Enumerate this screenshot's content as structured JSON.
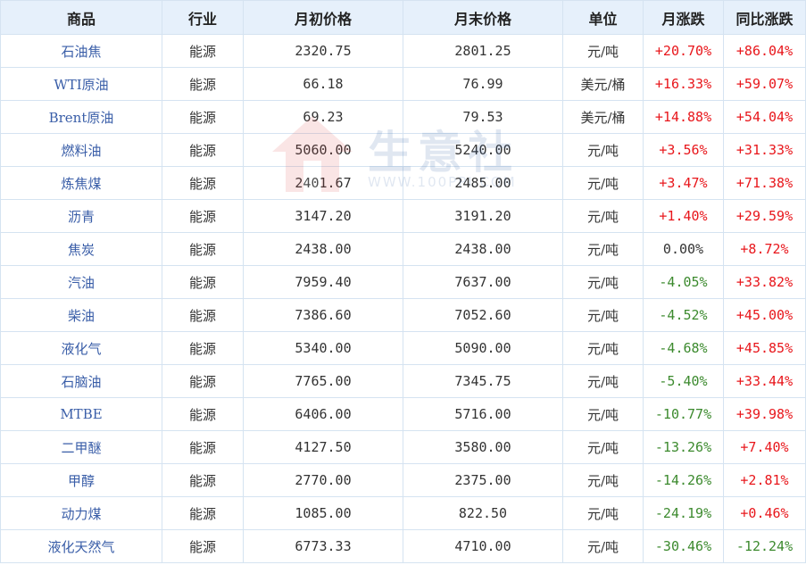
{
  "colors": {
    "up": "#e8161b",
    "down": "#3c8a2e",
    "flat": "#333333",
    "header_bg": "#e6f0fb",
    "name_link": "#3a5ea8",
    "border": "#d5e3f1"
  },
  "watermark": {
    "text": "生意社",
    "url": "WWW.100PPI.COM"
  },
  "headers": [
    "商品",
    "行业",
    "月初价格",
    "月末价格",
    "单位",
    "月涨跌",
    "同比涨跌"
  ],
  "rows": [
    {
      "name": "石油焦",
      "industry": "能源",
      "start": "2320.75",
      "end": "2801.25",
      "unit": "元/吨",
      "mom": "+20.70%",
      "mom_dir": "up",
      "yoy": "+86.04%",
      "yoy_dir": "up"
    },
    {
      "name": "WTI原油",
      "industry": "能源",
      "start": "66.18",
      "end": "76.99",
      "unit": "美元/桶",
      "mom": "+16.33%",
      "mom_dir": "up",
      "yoy": "+59.07%",
      "yoy_dir": "up"
    },
    {
      "name": "Brent原油",
      "industry": "能源",
      "start": "69.23",
      "end": "79.53",
      "unit": "美元/桶",
      "mom": "+14.88%",
      "mom_dir": "up",
      "yoy": "+54.04%",
      "yoy_dir": "up"
    },
    {
      "name": "燃料油",
      "industry": "能源",
      "start": "5060.00",
      "end": "5240.00",
      "unit": "元/吨",
      "mom": "+3.56%",
      "mom_dir": "up",
      "yoy": "+31.33%",
      "yoy_dir": "up"
    },
    {
      "name": "炼焦煤",
      "industry": "能源",
      "start": "2401.67",
      "end": "2485.00",
      "unit": "元/吨",
      "mom": "+3.47%",
      "mom_dir": "up",
      "yoy": "+71.38%",
      "yoy_dir": "up"
    },
    {
      "name": "沥青",
      "industry": "能源",
      "start": "3147.20",
      "end": "3191.20",
      "unit": "元/吨",
      "mom": "+1.40%",
      "mom_dir": "up",
      "yoy": "+29.59%",
      "yoy_dir": "up"
    },
    {
      "name": "焦炭",
      "industry": "能源",
      "start": "2438.00",
      "end": "2438.00",
      "unit": "元/吨",
      "mom": "0.00%",
      "mom_dir": "flat",
      "yoy": "+8.72%",
      "yoy_dir": "up"
    },
    {
      "name": "汽油",
      "industry": "能源",
      "start": "7959.40",
      "end": "7637.00",
      "unit": "元/吨",
      "mom": "-4.05%",
      "mom_dir": "down",
      "yoy": "+33.82%",
      "yoy_dir": "up"
    },
    {
      "name": "柴油",
      "industry": "能源",
      "start": "7386.60",
      "end": "7052.60",
      "unit": "元/吨",
      "mom": "-4.52%",
      "mom_dir": "down",
      "yoy": "+45.00%",
      "yoy_dir": "up"
    },
    {
      "name": "液化气",
      "industry": "能源",
      "start": "5340.00",
      "end": "5090.00",
      "unit": "元/吨",
      "mom": "-4.68%",
      "mom_dir": "down",
      "yoy": "+45.85%",
      "yoy_dir": "up"
    },
    {
      "name": "石脑油",
      "industry": "能源",
      "start": "7765.00",
      "end": "7345.75",
      "unit": "元/吨",
      "mom": "-5.40%",
      "mom_dir": "down",
      "yoy": "+33.44%",
      "yoy_dir": "up"
    },
    {
      "name": "MTBE",
      "industry": "能源",
      "start": "6406.00",
      "end": "5716.00",
      "unit": "元/吨",
      "mom": "-10.77%",
      "mom_dir": "down",
      "yoy": "+39.98%",
      "yoy_dir": "up"
    },
    {
      "name": "二甲醚",
      "industry": "能源",
      "start": "4127.50",
      "end": "3580.00",
      "unit": "元/吨",
      "mom": "-13.26%",
      "mom_dir": "down",
      "yoy": "+7.40%",
      "yoy_dir": "up"
    },
    {
      "name": "甲醇",
      "industry": "能源",
      "start": "2770.00",
      "end": "2375.00",
      "unit": "元/吨",
      "mom": "-14.26%",
      "mom_dir": "down",
      "yoy": "+2.81%",
      "yoy_dir": "up"
    },
    {
      "name": "动力煤",
      "industry": "能源",
      "start": "1085.00",
      "end": "822.50",
      "unit": "元/吨",
      "mom": "-24.19%",
      "mom_dir": "down",
      "yoy": "+0.46%",
      "yoy_dir": "up"
    },
    {
      "name": "液化天然气",
      "industry": "能源",
      "start": "6773.33",
      "end": "4710.00",
      "unit": "元/吨",
      "mom": "-30.46%",
      "mom_dir": "down",
      "yoy": "-12.24%",
      "yoy_dir": "down"
    }
  ]
}
